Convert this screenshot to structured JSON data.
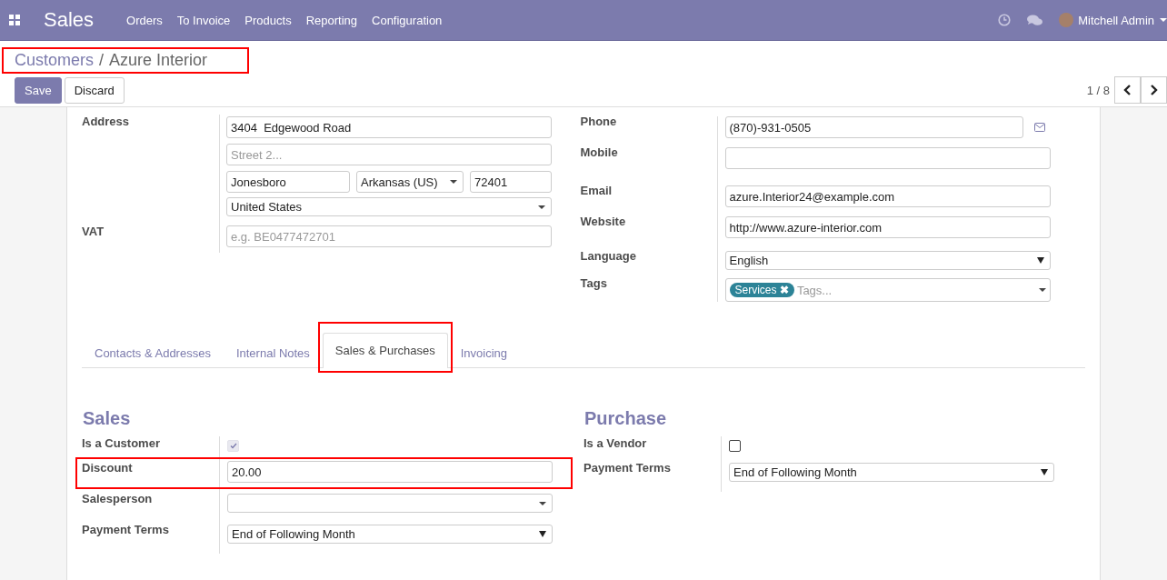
{
  "navbar": {
    "app": "Sales",
    "menu": [
      "Orders",
      "To Invoice",
      "Products",
      "Reporting",
      "Configuration"
    ],
    "user": "Mitchell Admin"
  },
  "breadcrumb": {
    "items": [
      "Customers",
      "Azure Interior"
    ],
    "separator": "/",
    "highlighted": true
  },
  "buttons": [
    {
      "label": "Save",
      "kind": "primary"
    },
    {
      "label": "Discard",
      "kind": "secondary"
    }
  ],
  "pager": {
    "text": "1 / 8"
  },
  "address": {
    "label": "Address",
    "street": "3404  Edgewood Road",
    "street2_placeholder": "Street 2...",
    "city": "Jonesboro",
    "state": "Arkansas (US)",
    "zip": "72401",
    "country": "United States"
  },
  "vat": {
    "label": "VAT",
    "placeholder": "e.g. BE0477472701"
  },
  "contact_fields": [
    {
      "label": "Phone",
      "kind": "phone",
      "value": "(870)-931-0505"
    },
    {
      "label": "Mobile",
      "kind": "text"
    },
    {
      "label": "Email",
      "kind": "text",
      "value": "azure.Interior24@example.com"
    },
    {
      "label": "Website",
      "kind": "text",
      "value": "http://www.azure-interior.com"
    },
    {
      "label": "Language",
      "kind": "select",
      "value": "English"
    },
    {
      "label": "Tags",
      "kind": "tags",
      "tags": [
        {
          "label": "Services",
          "color": "#2c8397",
          "remove_icon": "✖"
        }
      ],
      "placeholder": "Tags..."
    }
  ],
  "tabs": [
    {
      "label": "Contacts & Addresses",
      "selected": false,
      "highlighted": false
    },
    {
      "label": "Internal Notes",
      "selected": false,
      "highlighted": false
    },
    {
      "label": "Sales & Purchases",
      "selected": true,
      "highlighted": true
    },
    {
      "label": "Invoicing",
      "selected": false,
      "highlighted": false
    }
  ],
  "groups": [
    {
      "title": "Sales",
      "fields": [
        {
          "label": "Is a Customer",
          "kind": "checkbox",
          "checked": true,
          "disabled": true,
          "highlighted": false
        },
        {
          "label": "Discount",
          "kind": "text",
          "value": "20.00",
          "highlighted": true
        },
        {
          "label": "Salesperson",
          "kind": "many2one",
          "highlighted": false
        },
        {
          "label": "Payment Terms",
          "kind": "select",
          "value": "End of Following Month",
          "highlighted": false
        }
      ]
    },
    {
      "title": "Purchase",
      "fields": [
        {
          "label": "Is a Vendor",
          "kind": "checkbox",
          "checked": false,
          "disabled": false,
          "highlighted": false
        },
        {
          "label": "Payment Terms",
          "kind": "select",
          "value": "End of Following Month",
          "highlighted": false
        }
      ]
    }
  ]
}
